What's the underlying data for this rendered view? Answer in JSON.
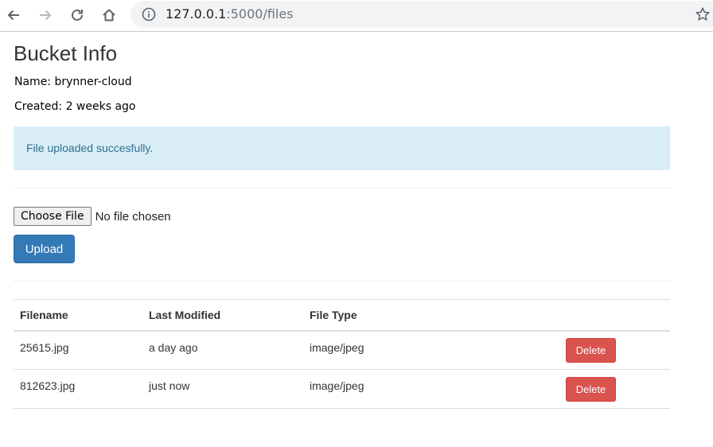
{
  "browser": {
    "url_host": "127.0.0.1",
    "url_path": ":5000/files"
  },
  "page": {
    "title": "Bucket Info",
    "name_line": "Name: brynner-cloud",
    "created_line": "Created: 2 weeks ago",
    "alert": "File uploaded succesfully.",
    "choose_file_label": "Choose File",
    "no_file_text": "No file chosen",
    "upload_label": "Upload"
  },
  "table": {
    "headers": [
      "Filename",
      "Last Modified",
      "File Type",
      ""
    ],
    "rows": [
      {
        "filename": "25615.jpg",
        "modified": "a day ago",
        "type": "image/jpeg",
        "action": "Delete"
      },
      {
        "filename": "812623.jpg",
        "modified": "just now",
        "type": "image/jpeg",
        "action": "Delete"
      }
    ]
  },
  "colors": {
    "alert_bg": "#d9edf7",
    "primary": "#337ab7",
    "danger": "#d9534f"
  },
  "icons": [
    "back-arrow-icon",
    "forward-arrow-icon",
    "reload-icon",
    "home-icon",
    "info-icon",
    "star-icon"
  ]
}
